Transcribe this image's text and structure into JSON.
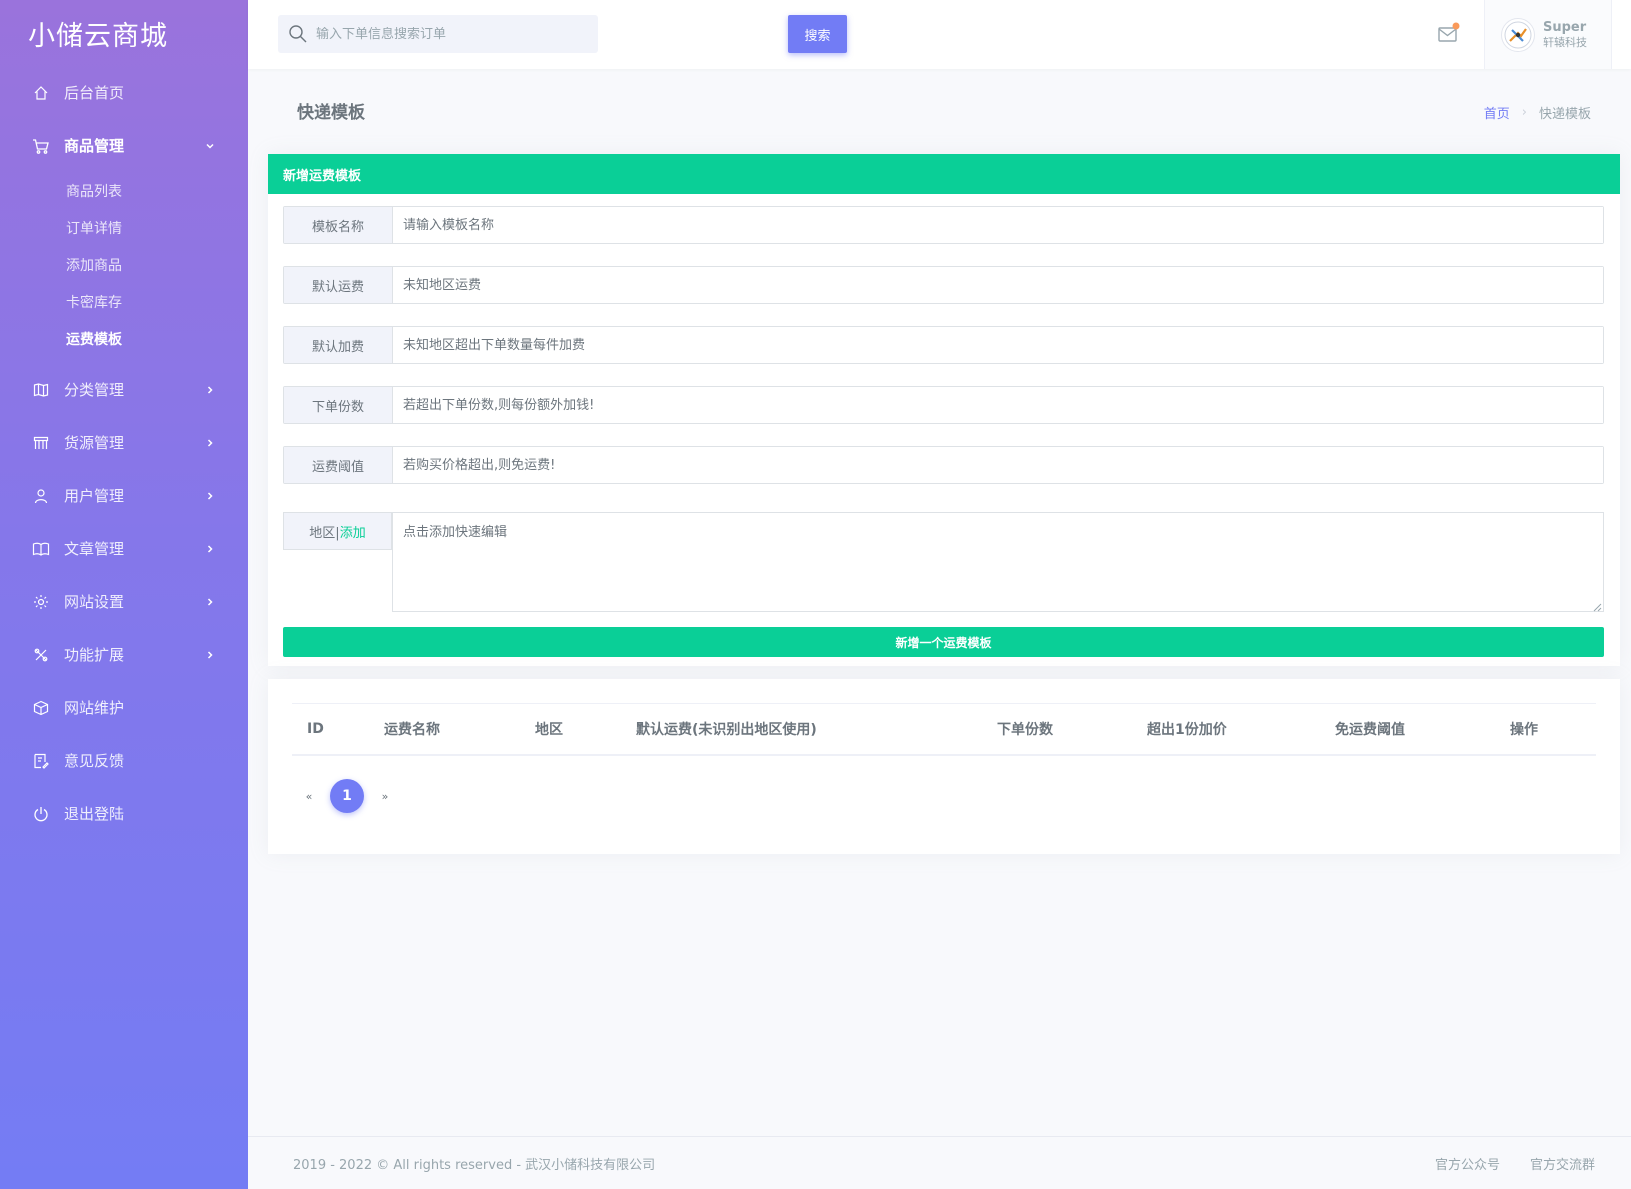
{
  "brand": "小储云商城",
  "sidebar": {
    "items": [
      {
        "key": "dashboard",
        "label": "后台首页",
        "icon": "home-icon"
      },
      {
        "key": "goods",
        "label": "商品管理",
        "icon": "cart-icon",
        "expanded": true,
        "children": [
          {
            "label": "商品列表"
          },
          {
            "label": "订单详情"
          },
          {
            "label": "添加商品"
          },
          {
            "label": "卡密库存"
          },
          {
            "label": "运费模板",
            "active": true
          }
        ]
      },
      {
        "key": "category",
        "label": "分类管理",
        "icon": "map-icon"
      },
      {
        "key": "supply",
        "label": "货源管理",
        "icon": "store-icon"
      },
      {
        "key": "users",
        "label": "用户管理",
        "icon": "user-icon"
      },
      {
        "key": "articles",
        "label": "文章管理",
        "icon": "book-icon"
      },
      {
        "key": "settings",
        "label": "网站设置",
        "icon": "gear-icon"
      },
      {
        "key": "extensions",
        "label": "功能扩展",
        "icon": "puzzle-icon"
      },
      {
        "key": "maintenance",
        "label": "网站维护",
        "icon": "box-icon"
      },
      {
        "key": "feedback",
        "label": "意见反馈",
        "icon": "feedback-icon"
      },
      {
        "key": "logout",
        "label": "退出登陆",
        "icon": "power-icon"
      }
    ]
  },
  "topbar": {
    "search_placeholder": "输入下单信息搜索订单",
    "search_button": "搜索",
    "user_name": "Super",
    "user_org": "轩辕科技"
  },
  "page": {
    "title": "快递模板",
    "breadcrumb_home": "首页",
    "breadcrumb_current": "快递模板"
  },
  "form": {
    "header": "新增运费模板",
    "fields": [
      {
        "label": "模板名称",
        "placeholder": "请输入模板名称"
      },
      {
        "label": "默认运费",
        "placeholder": "未知地区运费"
      },
      {
        "label": "默认加费",
        "placeholder": "未知地区超出下单数量每件加费"
      },
      {
        "label": "下单份数",
        "placeholder": "若超出下单份数,则每份额外加钱!"
      },
      {
        "label": "运费阈值",
        "placeholder": "若购买价格超出,则免运费!"
      }
    ],
    "region_label": "地区|",
    "region_add": "添加",
    "region_placeholder": "点击添加快速编辑",
    "submit": "新增一个运费模板"
  },
  "table": {
    "columns": [
      "ID",
      "运费名称",
      "地区",
      "默认运费(未识别出地区使用)",
      "下单份数",
      "超出1份加价",
      "免运费阈值",
      "操作"
    ],
    "rows": [],
    "pager": {
      "prev": "«",
      "current": "1",
      "next": "»"
    }
  },
  "footer": {
    "copyright": "2019 - 2022 © All rights reserved - 武汉小储科技有限公司",
    "links": [
      "官方公众号",
      "官方交流群"
    ]
  },
  "colors": {
    "primary": "#727cf5",
    "success": "#0acf97"
  }
}
